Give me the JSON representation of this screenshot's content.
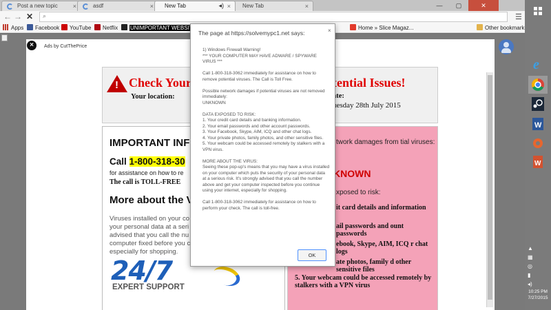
{
  "browser": {
    "tabs": [
      {
        "label": "Post a new topic",
        "active": false
      },
      {
        "label": "asdf",
        "active": false
      },
      {
        "label": "New Tab",
        "active": true,
        "audio": true
      },
      {
        "label": "New Tab",
        "active": false
      }
    ],
    "window_buttons": {
      "minimize": "—",
      "maximize": "▢",
      "close": "✕"
    },
    "bookmarks": [
      {
        "label": "Apps",
        "icon": "apps-icon",
        "color": "#c0392b"
      },
      {
        "label": "Facebook",
        "icon": "facebook-icon",
        "color": "#3b5998"
      },
      {
        "label": "YouTube",
        "icon": "youtube-icon",
        "color": "#cc0000"
      },
      {
        "label": "Netflix",
        "icon": "netflix-icon",
        "color": "#b00610"
      },
      {
        "label": "UNIMPORTANT WEBSITE",
        "icon": "website-icon",
        "color": "#000000"
      },
      {
        "label": "Home » Slice Magaz...",
        "icon": "slice-icon",
        "color": "#e23a2b"
      }
    ],
    "other_bookmarks": "Other bookmarks"
  },
  "ad": {
    "by_label": "Ads by CutThePrice"
  },
  "scam": {
    "headline_left": "Check Your",
    "headline_right": "tential Issues!",
    "location_label": "Your location:",
    "date_label": "ate:",
    "date_value": "uesday 28th July 2015",
    "important_title": "IMPORTANT INF",
    "call_prefix": "Call ",
    "call_number": "1-800-318-30",
    "assist_text": "for assistance on how to re",
    "tollfree_text": "The call is TOLL-FREE",
    "more_title": "More about the V",
    "virus_lines": [
      "Viruses installed on your co",
      "your personal data at a seri",
      "advised that you call the nu",
      "computer fixed before you c",
      "especially for shopping."
    ],
    "logo_text": "24/7",
    "logo_sub": "EXPERT SUPPORT",
    "pink_damage": "twork damages from tial viruses:",
    "pink_unknown": "KNOWN",
    "pink_exposed": "xposed to risk:",
    "pink_items": [
      "it card details and information",
      "ail passwords and ount passwords",
      "ebook, Skype, AIM, ICQ r chat logs",
      "ate photos, family d other sensitive files"
    ],
    "pink_item_5": "5.  Your webcam could be accessed remotely by stalkers with a VPN virus"
  },
  "dialog": {
    "title": "The page at https://solvemypc1.net says:",
    "close": "×",
    "paragraphs": [
      "1) Windows Firewall Warning!\n*** YOUR COMPUTER MAY HAVE ADWARE / SPYWARE VIRUS ***",
      "Call 1-800-318-3062 immediately for assistance on how to remove potential viruses. The Call is Toll Free.",
      "Possible network damages if potential viruses are not removed immediately:\nUNKNOWN",
      "DATA EXPOSED TO RISK:\n1. Your credit card details and banking information.\n2. Your email passwords and other account passwords.\n3. Your Facebook, Skype, AIM, ICQ and other chat logs.\n4. Your private photos, family photos, and other sensitive files.\n5. Your webcam could be accessed remotely by stalkers with a VPN virus.",
      "MORE ABOUT THE VIRUS:\nSeeing these pop-up's means that you may have a virus installed on your computer which puts the security of your personal data at a serious risk. It's strongly advised that you call the number above and get your computer inspected before you continue using your internet, especially for shopping.",
      "Call 1-800-318-3062 immediately for assistance on how to perform your check. The call is toll-free."
    ],
    "ok_label": "OK"
  },
  "taskbar": {
    "time": "10:25 PM",
    "date": "7/27/2015",
    "icons": [
      "ie-icon",
      "chrome-icon",
      "steam-icon",
      "word-icon",
      "settings-icon",
      "office-icon"
    ]
  }
}
